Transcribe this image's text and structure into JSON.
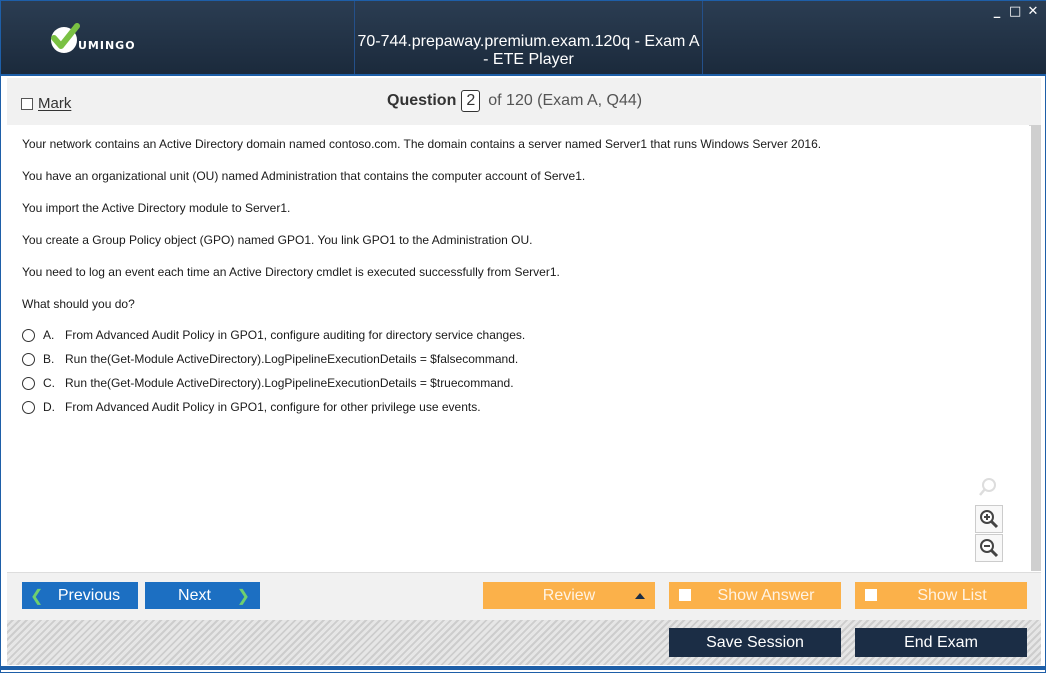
{
  "header": {
    "logo_text": "UMINGO",
    "title": "70-744.prepaway.premium.exam.120q - Exam A - ETE Player",
    "window_controls": {
      "minimize": "_",
      "maximize": "□",
      "close": "✕"
    }
  },
  "question_bar": {
    "mark_label": "Mark",
    "question_label": "Question",
    "question_number": "2",
    "of_text": "of 120 (Exam A, Q44)"
  },
  "question": {
    "paragraphs": [
      "Your network contains an Active Directory domain named contoso.com. The domain contains a server named Server1 that runs Windows Server 2016.",
      "You have an organizational unit (OU) named Administration that contains the computer account of Serve1.",
      "You import the Active Directory module to Server1.",
      "You create a Group Policy object (GPO) named GPO1. You link GPO1 to the Administration OU.",
      "You need to log an event each time an Active Directory cmdlet is executed successfully from Server1.",
      "What should you do?"
    ],
    "options": [
      {
        "letter": "A.",
        "text": "From Advanced Audit Policy in GPO1, configure auditing for directory service changes."
      },
      {
        "letter": "B.",
        "text": "Run the(Get-Module ActiveDirectory).LogPipelineExecutionDetails = $falsecommand."
      },
      {
        "letter": "C.",
        "text": "Run the(Get-Module ActiveDirectory).LogPipelineExecutionDetails = $truecommand."
      },
      {
        "letter": "D.",
        "text": "From Advanced Audit Policy in GPO1, configure for other privilege use events."
      }
    ]
  },
  "zoom": {
    "icons": [
      "search-icon",
      "zoom-in-icon",
      "zoom-out-icon"
    ]
  },
  "nav": {
    "previous": "Previous",
    "next": "Next",
    "review": "Review",
    "show_answer": "Show Answer",
    "show_list": "Show List"
  },
  "footer": {
    "save_session": "Save Session",
    "end_exam": "End Exam"
  },
  "colors": {
    "header_bg": "#1b2a3c",
    "accent_blue": "#1c6fc2",
    "orange": "#fbb14a",
    "dark_button": "#1b2d45",
    "logo_green": "#7ac143"
  }
}
